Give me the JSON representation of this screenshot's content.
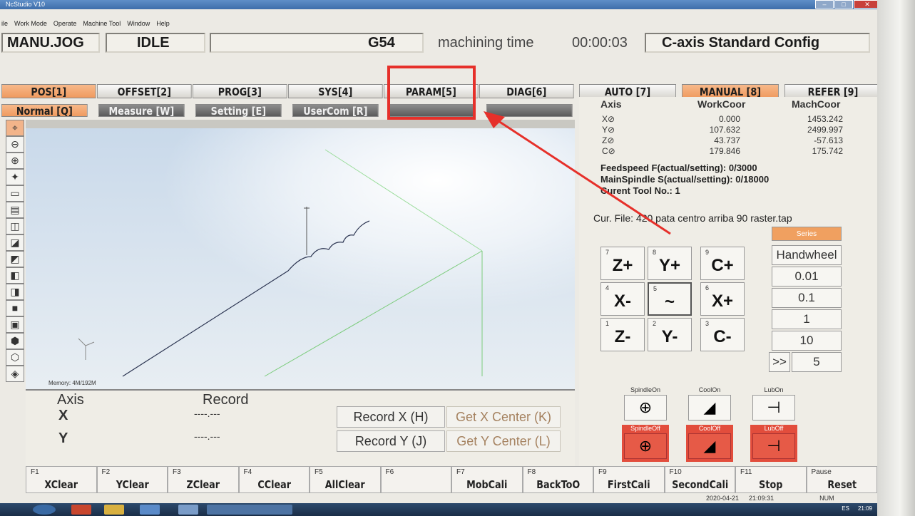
{
  "window": {
    "title": "NcStudio V10",
    "controls": [
      "–",
      "□",
      "✕"
    ]
  },
  "menu": [
    "ile",
    "Work Mode",
    "Operate",
    "Machine Tool",
    "Window",
    "Help"
  ],
  "status": {
    "mode": "MANU.JOG",
    "state": "IDLE",
    "empty": "",
    "coord": "G54",
    "time_label": "machining time",
    "time_value": "00:00:03",
    "config": "C-axis Standard Config"
  },
  "main_tabs": [
    "POS[1]",
    "OFFSET[2]",
    "PROG[3]",
    "SYS[4]",
    "PARAM[5]",
    "DIAG[6]"
  ],
  "sub_tabs": [
    "Normal [Q]",
    "Measure [W]",
    "Setting [E]",
    "UserCom [R]"
  ],
  "right_tabs": [
    "AUTO [7]",
    "MANUAL [8]",
    "REFER [9]"
  ],
  "toolbar_icons": [
    "crosshair-icon",
    "zoom-out-icon",
    "zoom-in-icon",
    "center-view-icon",
    "fit-window-icon",
    "clear-track-icon",
    "view-iso-icon",
    "view-top-icon",
    "view-front-icon",
    "view-left-icon",
    "view-right-icon",
    "view-bottom-icon",
    "view-back-icon",
    "cube-solid-icon",
    "cube-wire-icon",
    "cube-shaded-icon"
  ],
  "viewport": {
    "memory": "Memory: 4M/192M"
  },
  "record": {
    "axis_header": "Axis",
    "record_header": "Record",
    "rows": [
      {
        "axis": "X",
        "value": "----.---"
      },
      {
        "axis": "Y",
        "value": "----.---"
      }
    ],
    "buttons": [
      "Record X (H)",
      "Record Y (J)"
    ],
    "ghost_buttons": [
      "Get X Center (K)",
      "Get Y Center (L)"
    ]
  },
  "axes": {
    "header": {
      "axis": "Axis",
      "work": "WorkCoor",
      "mach": "MachCoor"
    },
    "rows": [
      {
        "name": "X⊘",
        "work": "0.000",
        "mach": "1453.242"
      },
      {
        "name": "Y⊘",
        "work": "107.632",
        "mach": "2499.997"
      },
      {
        "name": "Z⊘",
        "work": "43.737",
        "mach": "-57.613"
      },
      {
        "name": "C⊘",
        "work": "179.846",
        "mach": "175.742"
      }
    ]
  },
  "info": {
    "feed": "Feedspeed F(actual/setting):  0/3000",
    "spindle": "MainSpindle S(actual/setting):  0/18000",
    "tool": "Curent Tool No.:  1",
    "file": "Cur. File: 420 pata centro arriba 90 raster.tap"
  },
  "jog": [
    {
      "num": "7",
      "label": "Z+"
    },
    {
      "num": "8",
      "label": "Y+"
    },
    {
      "num": "9",
      "label": "C+"
    },
    {
      "num": "4",
      "label": "X-"
    },
    {
      "num": "5",
      "label": "~"
    },
    {
      "num": "6",
      "label": "X+"
    },
    {
      "num": "1",
      "label": "Z-"
    },
    {
      "num": "2",
      "label": "Y-"
    },
    {
      "num": "3",
      "label": "C-"
    }
  ],
  "steps": {
    "series": "Series",
    "items": [
      "Handwheel",
      "0.01",
      "0.1",
      "1",
      "10"
    ],
    "more": ">>",
    "more_value": "5"
  },
  "aux": [
    {
      "label": "SpindleOn"
    },
    {
      "label": "CoolOn"
    },
    {
      "label": "LubOn"
    },
    {
      "label": "SpindleOff"
    },
    {
      "label": "CoolOff"
    },
    {
      "label": "LubOff"
    }
  ],
  "fkeys": [
    {
      "key": "F1",
      "label": "XClear"
    },
    {
      "key": "F2",
      "label": "YClear"
    },
    {
      "key": "F3",
      "label": "ZClear"
    },
    {
      "key": "F4",
      "label": "CClear"
    },
    {
      "key": "F5",
      "label": "AllClear"
    },
    {
      "key": "F6",
      "label": ""
    },
    {
      "key": "F7",
      "label": "MobCali"
    },
    {
      "key": "F8",
      "label": "BackToO"
    },
    {
      "key": "F9",
      "label": "FirstCali"
    },
    {
      "key": "F10",
      "label": "SecondCali"
    },
    {
      "key": "F11",
      "label": "Stop"
    },
    {
      "key": "Pause",
      "label": "Reset"
    }
  ],
  "bottom": {
    "date": "2020-04-21",
    "time": "21:09:31",
    "num": "NUM",
    "tray_lang": "ES",
    "tray_time": "21:09"
  },
  "colors": {
    "active_tab": "#ef9a5f",
    "highlight": "#e6302a",
    "off_button": "#e24d3c"
  }
}
